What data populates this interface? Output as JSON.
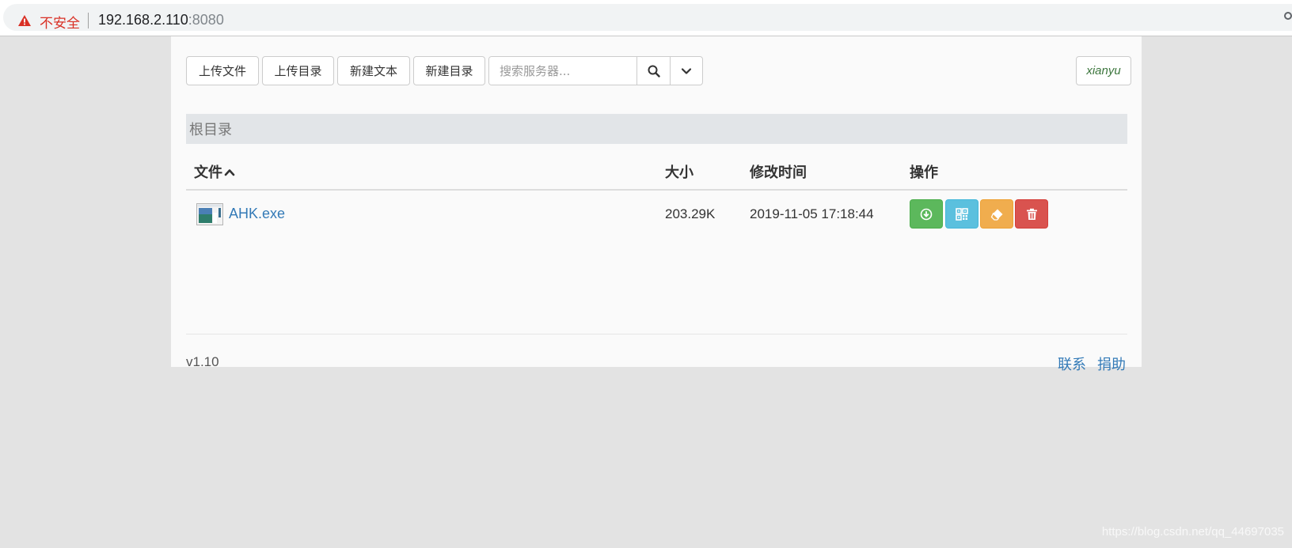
{
  "browser": {
    "security_label": "不安全",
    "url_host": "192.168.2.110",
    "url_port": ":8080"
  },
  "toolbar": {
    "upload_file": "上传文件",
    "upload_dir": "上传目录",
    "new_text": "新建文本",
    "new_dir": "新建目录",
    "search_placeholder": "搜索服务器...",
    "user": "xianyu"
  },
  "breadcrumb": "根目录",
  "table": {
    "headers": {
      "file": "文件",
      "size": "大小",
      "mtime": "修改时间",
      "ops": "操作"
    },
    "rows": [
      {
        "name": "AHK.exe",
        "size": "203.29K",
        "mtime": "2019-11-05 17:18:44"
      }
    ],
    "op_icons": [
      "download-icon",
      "qrcode-icon",
      "eraser-icon",
      "trash-icon"
    ]
  },
  "footer": {
    "version": "v1.10",
    "contact": "联系",
    "donate": "捐助"
  },
  "watermark": "https://blog.csdn.net/qq_44697035",
  "colors": {
    "download": "#5cb85c",
    "qrcode": "#5bc0de",
    "rename": "#f0ad4e",
    "delete": "#d9534f",
    "link": "#337ab7",
    "user": "#3c763d",
    "insecure": "#d93025"
  }
}
